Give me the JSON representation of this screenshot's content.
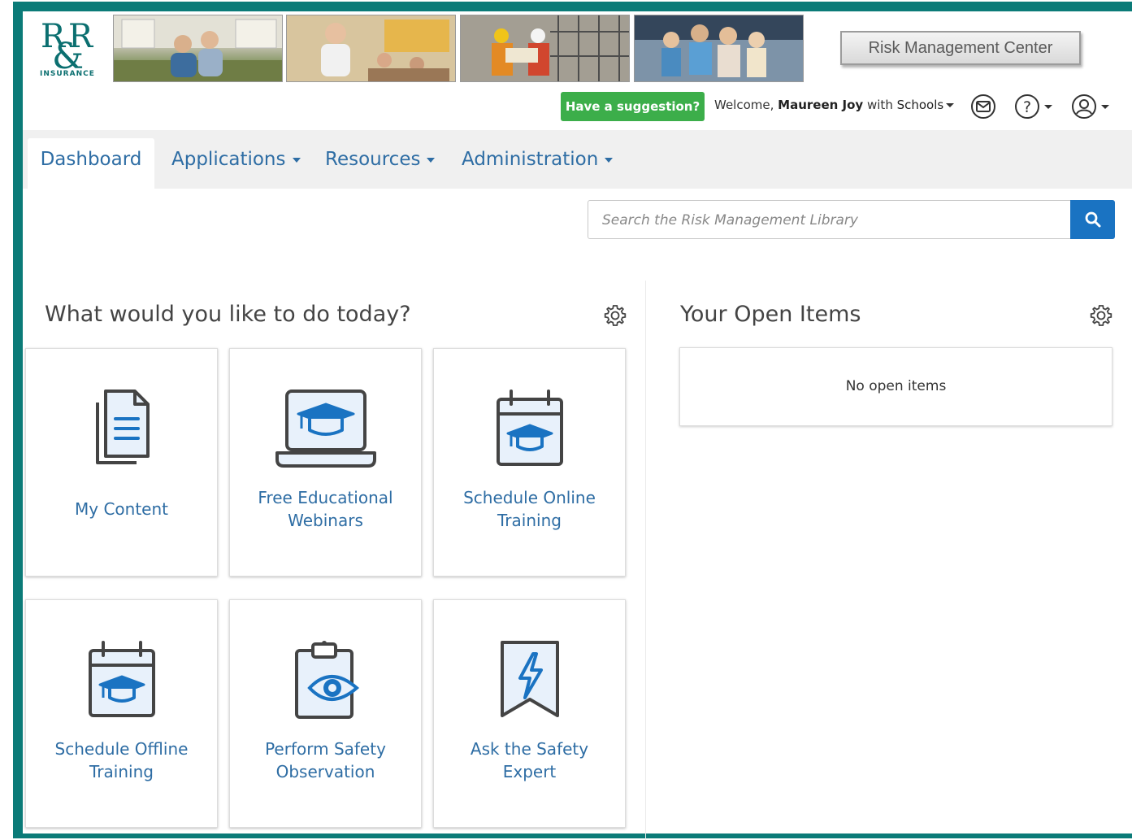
{
  "header": {
    "logo_text": "R&R",
    "logo_subtext": "INSURANCE",
    "rmc_button": "Risk Management Center",
    "suggestion_button": "Have a suggestion?",
    "welcome_prefix": "Welcome,",
    "user_name": "Maureen Joy",
    "with_text": "with",
    "org_name": "Schools"
  },
  "nav": {
    "tabs": [
      {
        "label": "Dashboard",
        "active": true
      },
      {
        "label": "Applications",
        "dropdown": true
      },
      {
        "label": "Resources",
        "dropdown": true
      },
      {
        "label": "Administration",
        "dropdown": true
      }
    ]
  },
  "search": {
    "placeholder": "Search the Risk Management Library"
  },
  "today": {
    "title": "What would you like to do today?",
    "cards": [
      {
        "label": "My Content",
        "icon": "document-icon"
      },
      {
        "label": "Free Educational Webinars",
        "icon": "laptop-graduation-icon"
      },
      {
        "label": "Schedule Online Training",
        "icon": "calendar-graduation-icon"
      },
      {
        "label": "Schedule Offline Training",
        "icon": "calendar-graduation-icon"
      },
      {
        "label": "Perform Safety Observation",
        "icon": "clipboard-eye-icon"
      },
      {
        "label": "Ask the Safety Expert",
        "icon": "bookmark-bolt-icon"
      }
    ]
  },
  "open_items": {
    "title": "Your Open Items",
    "empty_text": "No open items"
  },
  "colors": {
    "frame": "#0b7b78",
    "link": "#2e6da4",
    "icon_dark": "#444444",
    "icon_accent": "#1a73c2",
    "suggest_green": "#3cae4a"
  }
}
